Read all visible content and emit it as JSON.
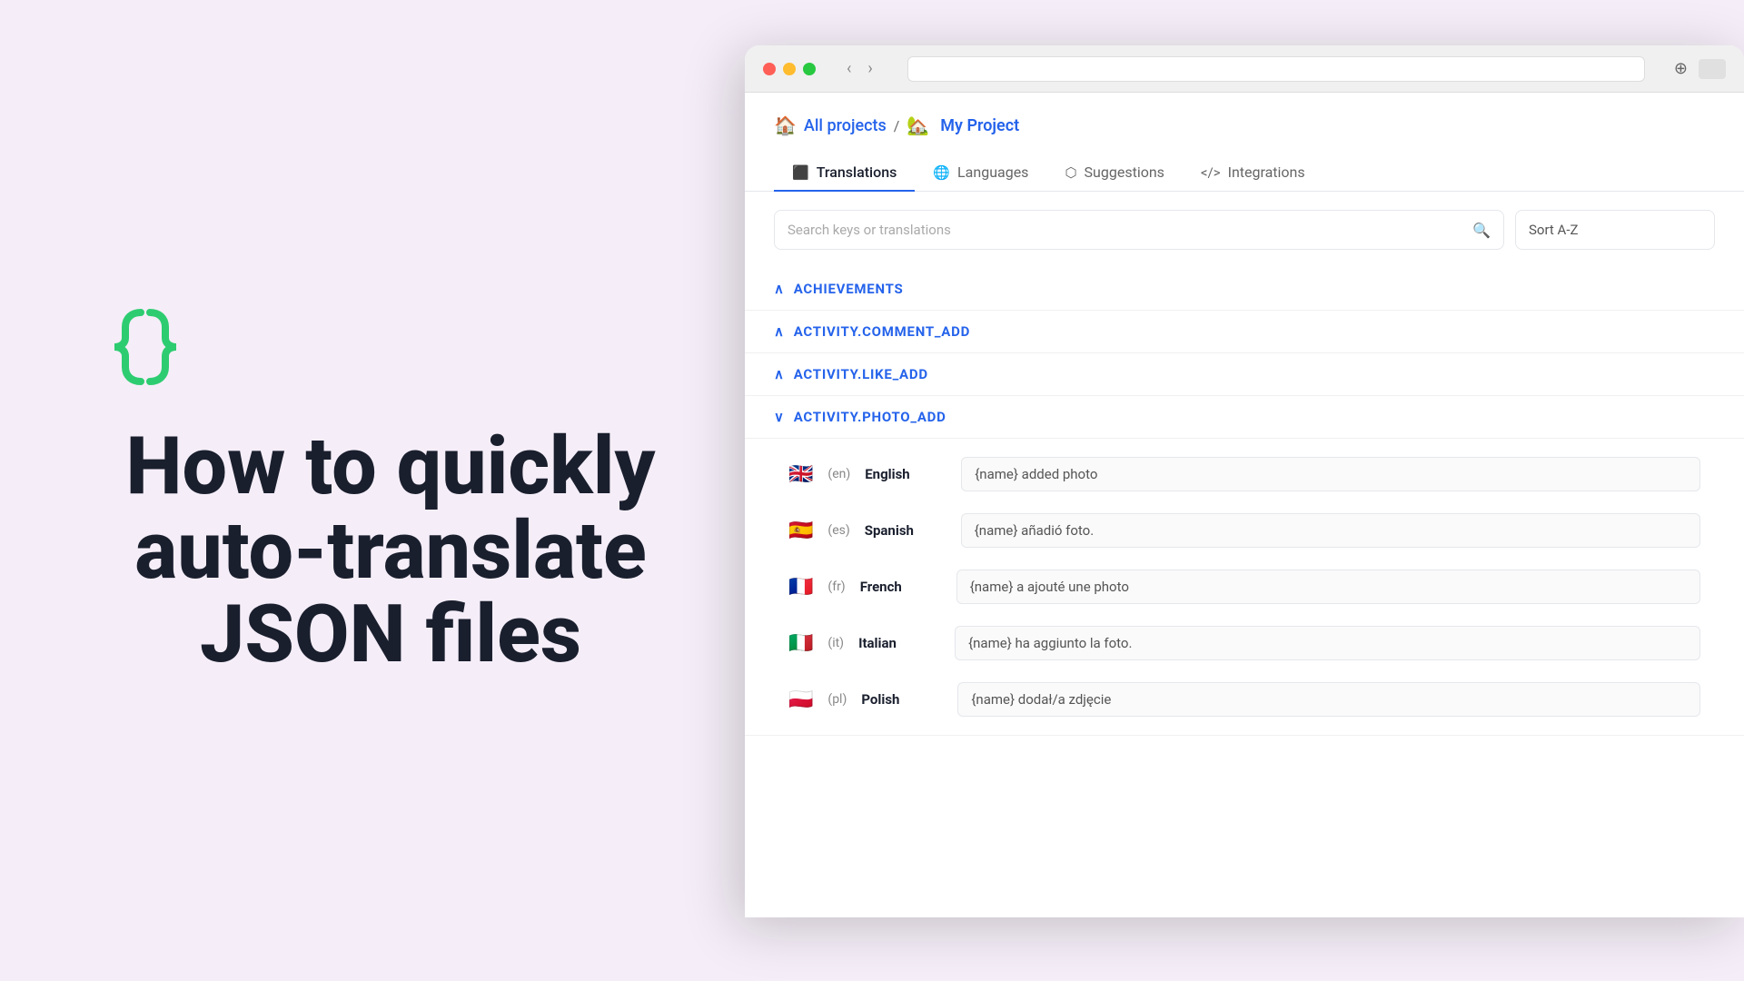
{
  "background_color": "#f5eef8",
  "left": {
    "logo_icon_label": "curly-braces-icon",
    "headline_line1": "How to quickly",
    "headline_line2": "auto-translate",
    "headline_line3": "JSON files"
  },
  "browser": {
    "title_bar": {
      "traffic_lights": [
        "red",
        "yellow",
        "green"
      ],
      "nav_back_label": "‹",
      "nav_forward_label": "›"
    },
    "breadcrumb": {
      "home_icon": "🏠",
      "all_projects_label": "All projects",
      "separator": "/",
      "project_icon": "🏡",
      "project_name": "My Project"
    },
    "tabs": [
      {
        "id": "translations",
        "icon": "⬛",
        "label": "Translations",
        "active": true
      },
      {
        "id": "languages",
        "icon": "🌐",
        "label": "Languages",
        "active": false
      },
      {
        "id": "suggestions",
        "icon": "⬡",
        "label": "Suggestions",
        "active": false
      },
      {
        "id": "integrations",
        "icon": "</>",
        "label": "Integrations",
        "active": false
      }
    ],
    "search": {
      "placeholder": "Search keys or translations",
      "sort_label": "Sort A-Z"
    },
    "key_groups": [
      {
        "id": "achievements",
        "label": "ACHIEVEMENTS",
        "expanded": false,
        "chevron": "^"
      },
      {
        "id": "activity_comment_add",
        "label": "ACTIVITY.COMMENT_ADD",
        "expanded": false,
        "chevron": "^"
      },
      {
        "id": "activity_like_add",
        "label": "ACTIVITY.LIKE_ADD",
        "expanded": false,
        "chevron": "^"
      },
      {
        "id": "activity_photo_add",
        "label": "ACTIVITY.PHOTO_ADD",
        "expanded": true,
        "chevron": "v",
        "translations": [
          {
            "flag": "🇬🇧",
            "code": "en",
            "name": "English",
            "value": "{name} added photo"
          },
          {
            "flag": "🇪🇸",
            "code": "es",
            "name": "Spanish",
            "value": "{name} añadió foto."
          },
          {
            "flag": "🇫🇷",
            "code": "fr",
            "name": "French",
            "value": "{name} a ajouté une photo"
          },
          {
            "flag": "🇮🇹",
            "code": "it",
            "name": "Italian",
            "value": "{name} ha aggiunto la foto."
          },
          {
            "flag": "🇵🇱",
            "code": "pl",
            "name": "Polish",
            "value": "{name} dodał/a zdjęcie"
          }
        ]
      }
    ]
  }
}
